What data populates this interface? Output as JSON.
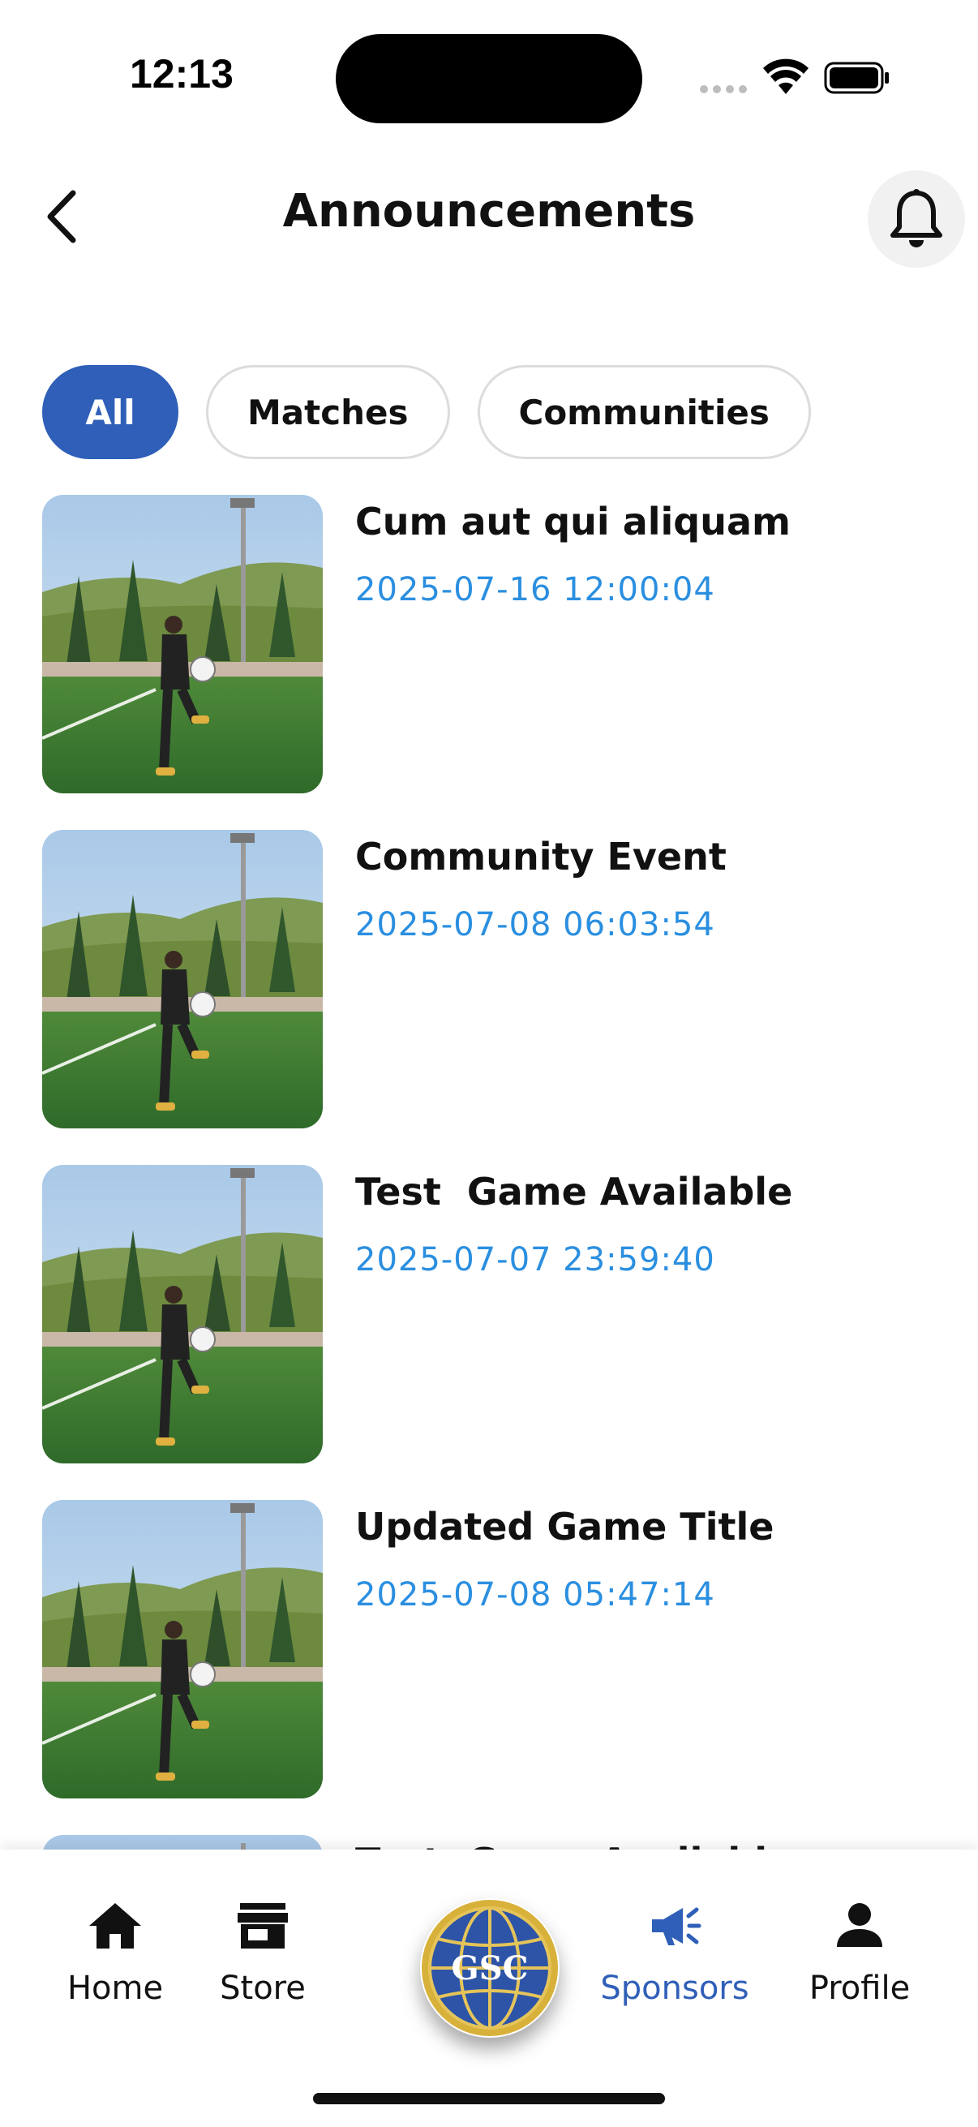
{
  "status_bar": {
    "time": "12:13"
  },
  "header": {
    "title": "Announcements",
    "back_icon": "chevron-left-icon",
    "bell_icon": "bell-icon"
  },
  "filters": [
    {
      "label": "All",
      "active": true
    },
    {
      "label": "Matches",
      "active": false
    },
    {
      "label": "Communities",
      "active": false
    }
  ],
  "announcements": [
    {
      "title": "Cum aut qui aliquam",
      "date": "2025-07-16 12:00:04"
    },
    {
      "title": "Community Event",
      "date": "2025-07-08 06:03:54"
    },
    {
      "title": "Test  Game Available",
      "date": "2025-07-07 23:59:40"
    },
    {
      "title": "Updated Game Title",
      "date": "2025-07-08 05:47:14"
    },
    {
      "title": "Test  Game Available",
      "date": ""
    }
  ],
  "bottom_nav": {
    "items": [
      {
        "label": "Home",
        "icon": "home-icon",
        "active": false
      },
      {
        "label": "Store",
        "icon": "store-icon",
        "active": false
      },
      {
        "label": "Sponsors",
        "icon": "megaphone-icon",
        "active": true
      },
      {
        "label": "Profile",
        "icon": "person-icon",
        "active": false
      }
    ],
    "center_logo": "gsc-globe-logo"
  },
  "colors": {
    "accent": "#2f5fb8",
    "date_text": "#2b8fe0",
    "chip_border": "#dcdcdc"
  }
}
